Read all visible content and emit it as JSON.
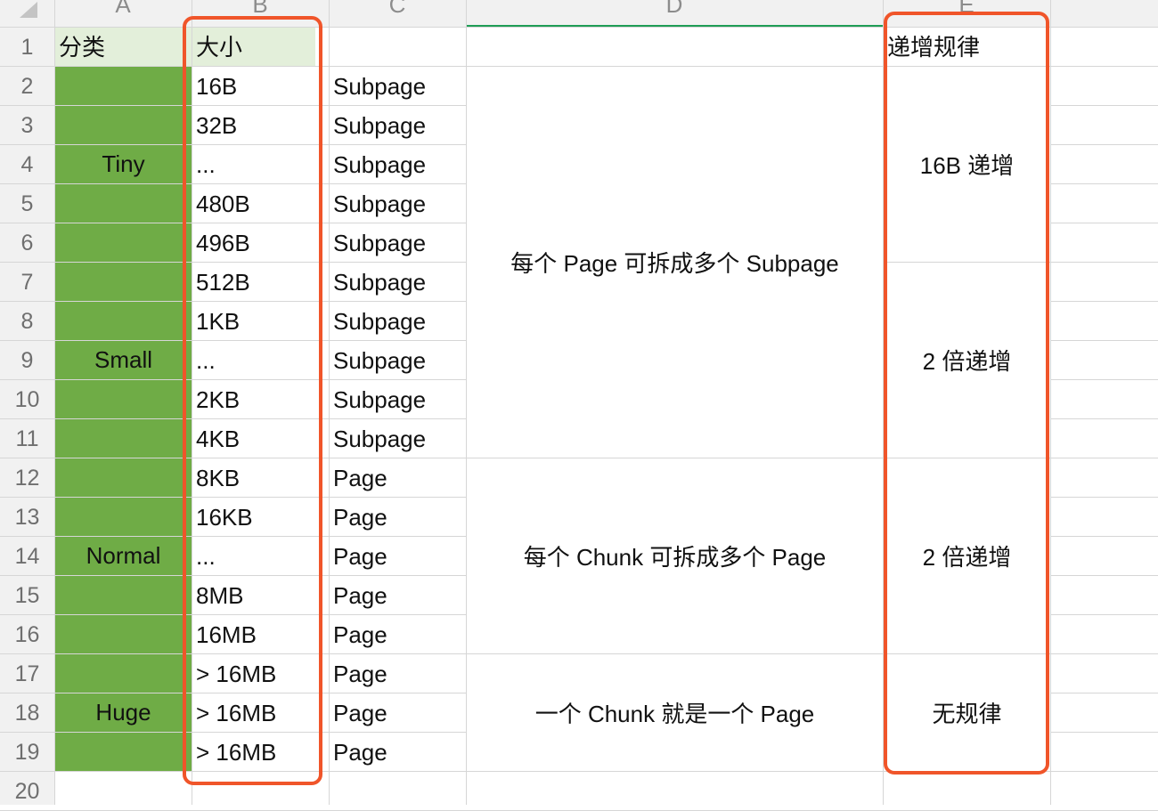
{
  "columns": [
    "A",
    "B",
    "C",
    "D",
    "E"
  ],
  "rows": [
    "1",
    "2",
    "3",
    "4",
    "5",
    "6",
    "7",
    "8",
    "9",
    "10",
    "11",
    "12",
    "13",
    "14",
    "15",
    "16",
    "17",
    "18",
    "19",
    "20"
  ],
  "header_row": {
    "A": "分类",
    "B": "大小",
    "E": "递增规律"
  },
  "categories": [
    "Tiny",
    "Small",
    "Normal",
    "Huge"
  ],
  "sizes": [
    "16B",
    "32B",
    "...",
    "480B",
    "496B",
    "512B",
    "1KB",
    "...",
    "2KB",
    "4KB",
    "8KB",
    "16KB",
    "...",
    "8MB",
    "16MB",
    "> 16MB",
    "> 16MB",
    "> 16MB"
  ],
  "types": [
    "Subpage",
    "Subpage",
    "Subpage",
    "Subpage",
    "Subpage",
    "Subpage",
    "Subpage",
    "Subpage",
    "Subpage",
    "Subpage",
    "Page",
    "Page",
    "Page",
    "Page",
    "Page",
    "Page",
    "Page",
    "Page"
  ],
  "descriptions": [
    "每个 Page 可拆成多个 Subpage",
    "每个 Chunk 可拆成多个 Page",
    "一个 Chunk 就是一个 Page"
  ],
  "growth": [
    "16B 递增",
    "2 倍递增",
    "2 倍递增",
    "无规律"
  ],
  "colors": {
    "category_fill": "#6fac46",
    "header_fill": "#e3efda",
    "callout": "#f0552a",
    "selected_column": "#1f9d55"
  }
}
